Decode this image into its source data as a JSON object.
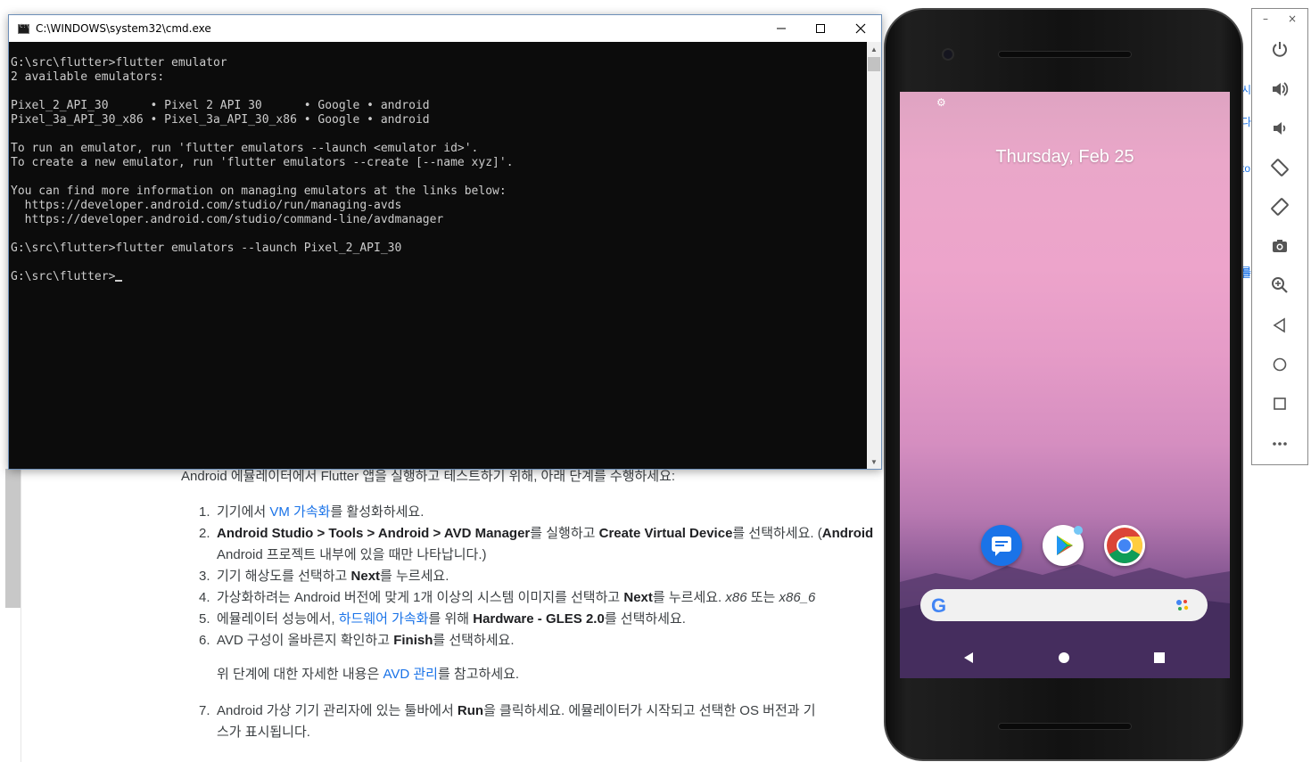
{
  "web_page": {
    "intro": "Android 에뮬레이터에서 Flutter 앱을 실행하고 테스트하기 위해, 아래 단계를 수행하세요:",
    "steps": [
      {
        "num": "1.",
        "parts": [
          {
            "t": "기기에서 "
          },
          {
            "t": "VM 가속화",
            "link": true
          },
          {
            "t": "를 활성화하세요."
          }
        ]
      },
      {
        "num": "2.",
        "parts": [
          {
            "t": "Android Studio > Tools > Android > AVD Manager",
            "bold": true
          },
          {
            "t": "를 실행하고 "
          },
          {
            "t": "Create Virtual Device",
            "bold": true
          },
          {
            "t": "를 선택하세요. ("
          },
          {
            "t": "Android",
            "bold": true
          }
        ],
        "line2": "Android 프로젝트 내부에 있을 때만 나타납니다.)"
      },
      {
        "num": "3.",
        "parts": [
          {
            "t": "기기 해상도를 선택하고 "
          },
          {
            "t": "Next",
            "bold": true
          },
          {
            "t": "를 누르세요."
          }
        ]
      },
      {
        "num": "4.",
        "parts": [
          {
            "t": "가상화하려는 Android 버전에 맞게 1개 이상의 시스템 이미지를 선택하고 "
          },
          {
            "t": "Next",
            "bold": true
          },
          {
            "t": "를 누르세요. "
          },
          {
            "t": "x86",
            "italic": true
          },
          {
            "t": " 또는 "
          },
          {
            "t": "x86_6",
            "italic": true
          }
        ]
      },
      {
        "num": "5.",
        "parts": [
          {
            "t": "에뮬레이터 성능에서, "
          },
          {
            "t": "하드웨어 가속화",
            "link": true
          },
          {
            "t": "를 위해 "
          },
          {
            "t": "Hardware - GLES 2.0",
            "bold": true
          },
          {
            "t": "를 선택하세요."
          }
        ]
      },
      {
        "num": "6.",
        "parts": [
          {
            "t": "AVD 구성이 올바른지 확인하고 "
          },
          {
            "t": "Finish",
            "bold": true
          },
          {
            "t": "를 선택하세요."
          }
        ]
      }
    ],
    "note": {
      "before": "위 단계에 대한 자세한 내용은 ",
      "link": "AVD 관리",
      "after": "를 참고하세요."
    },
    "step7": {
      "num": "7.",
      "parts": [
        {
          "t": "Android 가상 기기 관리자에 있는 툴바에서 "
        },
        {
          "t": "Run",
          "bold": true
        },
        {
          "t": "을 클릭하세요. 에뮬레이터가 시작되고 선택한 OS 버전과 기"
        }
      ],
      "line2": "스가 표시됩니다."
    },
    "right_peek": [
      "시",
      "다",
      "to",
      "를",
      "를"
    ]
  },
  "cmd_window": {
    "title": "C:\\WINDOWS\\system32\\cmd.exe",
    "controls": {
      "minimize": "—",
      "maximize": "☐",
      "close": "✕"
    },
    "lines": [
      "G:\\src\\flutter>flutter emulator",
      "2 available emulators:",
      "",
      "Pixel_2_API_30      • Pixel 2 API 30      • Google • android",
      "Pixel_3a_API_30_x86 • Pixel_3a_API_30_x86 • Google • android",
      "",
      "To run an emulator, run 'flutter emulators --launch <emulator id>'.",
      "To create a new emulator, run 'flutter emulators --create [--name xyz]'.",
      "",
      "You can find more information on managing emulators at the links below:",
      "  https://developer.android.com/studio/run/managing-avds",
      "  https://developer.android.com/studio/command-line/avdmanager",
      "",
      "G:\\src\\flutter>flutter emulators --launch Pixel_2_API_30",
      ""
    ],
    "prompt": "G:\\src\\flutter>"
  },
  "phone": {
    "date": "Thursday, Feb 25",
    "apps": [
      {
        "name": "Messages",
        "icon": "messages-icon"
      },
      {
        "name": "Play Store",
        "icon": "play-store-icon"
      },
      {
        "name": "Chrome",
        "icon": "chrome-icon"
      }
    ],
    "search_logo": "G"
  },
  "emulator_toolbar": {
    "controls": {
      "minimize": "–",
      "close": "×"
    },
    "buttons": [
      "power-icon",
      "volume-up-icon",
      "volume-down-icon",
      "rotate-left-icon",
      "rotate-right-icon",
      "camera-icon",
      "zoom-icon",
      "back-icon",
      "home-icon",
      "overview-icon",
      "more-icon"
    ]
  },
  "colors": {
    "link": "#1a73e8",
    "terminal_bg": "#0c0c0c",
    "terminal_fg": "#cccccc"
  }
}
